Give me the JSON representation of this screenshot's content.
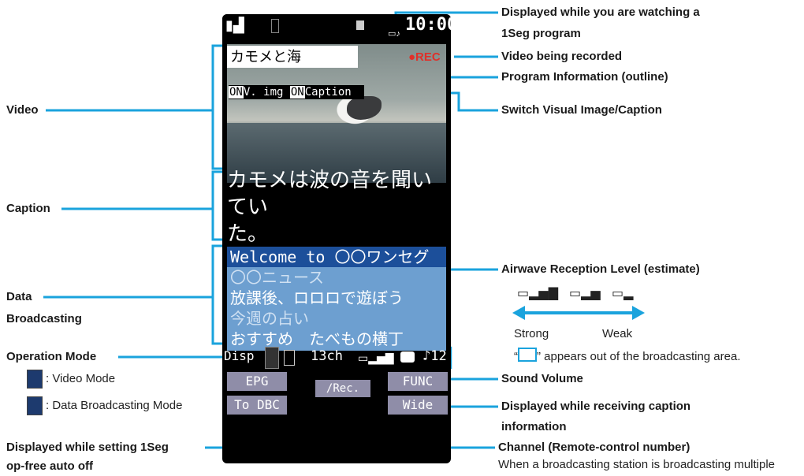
{
  "phone": {
    "clock": "10:00",
    "rec": "●REC",
    "program_info": "カモメと海",
    "switch_on1": "ON",
    "switch_vimg": "V. img",
    "switch_on2": "ON",
    "switch_caption": "Caption",
    "caption_line1": "カモメは波の音を聞いてい",
    "caption_line2": "た。",
    "dbc_items": [
      "Welcome to 〇〇ワンセグ",
      "〇〇ニュース",
      "放課後、ロロロで遊ぼう",
      "今週の占い",
      "おすすめ　たべもの横丁"
    ],
    "disp": "Disp",
    "channel": "13ch",
    "volume": "12",
    "softkey_epg": "EPG",
    "softkey_func": "FUNC",
    "softkey_todbc": "To DBC",
    "softkey_wide": "Wide",
    "center_key": "/Rec."
  },
  "labels": {
    "video": "Video",
    "caption": "Caption",
    "data1": "Data",
    "data2": "Broadcasting",
    "op_mode": "Operation Mode",
    "video_mode": ": Video Mode",
    "data_mode": ": Data Broadcasting Mode",
    "autooff1": "Displayed while setting 1Seg",
    "autooff2": "op-free auto off",
    "watching1": "Displayed while you are watching a",
    "watching2": "1Seg program",
    "recording": "Video being recorded",
    "prog_info": "Program Information (outline)",
    "switch": "Switch Visual Image/Caption",
    "airwave": "Airwave Reception Level (estimate)",
    "strong": "Strong",
    "weak": "Weak",
    "out_of_area_q1": "“",
    "out_of_area_text": "” appears out of the broadcasting area.",
    "sound": "Sound Volume",
    "receiving1": "Displayed while receiving caption",
    "receiving2": "information",
    "channel1": "Channel (Remote-control number)",
    "channel2": "When a broadcasting station is broadcasting multiple"
  },
  "colors": {
    "leader": "#1aa3dd",
    "dbc_bg": "#6d9fd0",
    "rec": "#e0302a",
    "softkey": "#8f8da8"
  },
  "icons": [
    "antenna-icon",
    "battery-icon",
    "onseg-icon",
    "tv-video-mode-icon",
    "tv-data-mode-icon",
    "auto-off-icon",
    "signal-strong-icon",
    "signal-medium-icon",
    "signal-weak-icon",
    "out-of-area-icon",
    "caption-icon",
    "volume-icon"
  ]
}
